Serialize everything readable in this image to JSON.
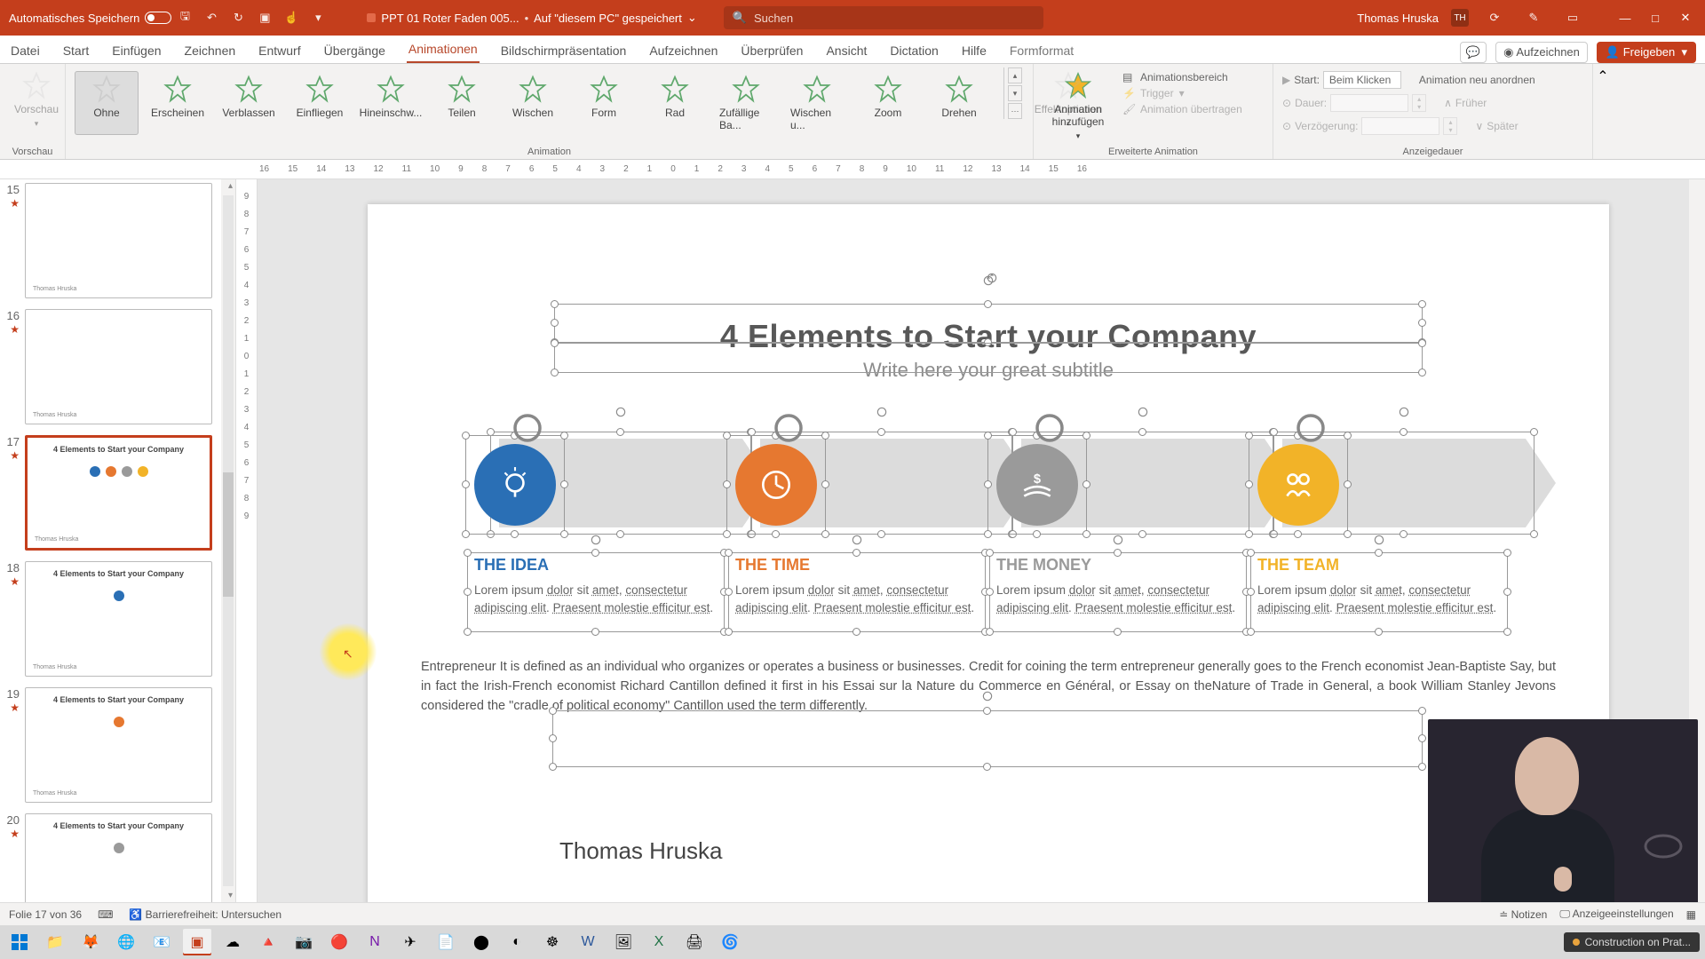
{
  "titlebar": {
    "autosave": "Automatisches Speichern",
    "filename": "PPT 01 Roter Faden 005...",
    "save_location": "Auf \"diesem PC\" gespeichert",
    "search_placeholder": "Suchen",
    "user": "Thomas Hruska",
    "initials": "TH"
  },
  "tabs": {
    "items": [
      "Datei",
      "Start",
      "Einfügen",
      "Zeichnen",
      "Entwurf",
      "Übergänge",
      "Animationen",
      "Bildschirmpräsentation",
      "Aufzeichnen",
      "Überprüfen",
      "Ansicht",
      "Dictation",
      "Hilfe",
      "Formformat"
    ],
    "active": "Animationen",
    "record": "Aufzeichnen",
    "share": "Freigeben"
  },
  "ribbon": {
    "preview": "Vorschau",
    "animation_label": "Animation",
    "gallery": [
      "Ohne",
      "Erscheinen",
      "Verblassen",
      "Einfliegen",
      "Hineinschw...",
      "Teilen",
      "Wischen",
      "Form",
      "Rad",
      "Zufällige Ba...",
      "Wischen u...",
      "Zoom",
      "Drehen"
    ],
    "effect_options": "Effektoptionen",
    "add_anim": "Animation hinzufügen",
    "adv_label": "Erweiterte Animation",
    "pane": "Animationsbereich",
    "trigger": "Trigger",
    "painter": "Animation übertragen",
    "timing_label": "Anzeigedauer",
    "start_lbl": "Start:",
    "start_val": "Beim Klicken",
    "dur_lbl": "Dauer:",
    "delay_lbl": "Verzögerung:",
    "reorder": "Animation neu anordnen",
    "earlier": "Früher",
    "later": "Später"
  },
  "ruler": {
    "h": [
      "16",
      "15",
      "14",
      "13",
      "12",
      "11",
      "10",
      "9",
      "8",
      "7",
      "6",
      "5",
      "4",
      "3",
      "2",
      "1",
      "0",
      "1",
      "2",
      "3",
      "4",
      "5",
      "6",
      "7",
      "8",
      "9",
      "10",
      "11",
      "12",
      "13",
      "14",
      "15",
      "16"
    ],
    "v": [
      "9",
      "8",
      "7",
      "6",
      "5",
      "4",
      "3",
      "2",
      "1",
      "0",
      "1",
      "2",
      "3",
      "4",
      "5",
      "6",
      "7",
      "8",
      "9"
    ]
  },
  "thumbs": [
    {
      "num": "15",
      "title": "",
      "dots": []
    },
    {
      "num": "16",
      "title": "",
      "dots": []
    },
    {
      "num": "17",
      "title": "4 Elements to Start your Company",
      "dots": [
        "#2a6fb5",
        "#e67830",
        "#9a9a9a",
        "#f2b328"
      ],
      "sel": true
    },
    {
      "num": "18",
      "title": "4 Elements to Start your Company",
      "dots": [
        "#2a6fb5"
      ]
    },
    {
      "num": "19",
      "title": "4 Elements to Start your Company",
      "dots": [
        "#e67830"
      ]
    },
    {
      "num": "20",
      "title": "4 Elements to Start your Company",
      "dots": [
        "#9a9a9a"
      ]
    }
  ],
  "slide": {
    "title": "4 Elements to Start your Company",
    "subtitle": "Write here your great subtitle",
    "elements": [
      {
        "title": "THE IDEA",
        "color": "blue"
      },
      {
        "title": "THE TIME",
        "color": "orange"
      },
      {
        "title": "THE MONEY",
        "color": "grey"
      },
      {
        "title": "THE TEAM",
        "color": "gold"
      }
    ],
    "lorem": "Lorem ipsum dolor sit amet, consectetur adipiscing elit. Praesent molestie efficitur est.",
    "para": "Entrepreneur   It is defined as an individual who organizes or operates a business or businesses. Credit for coining the term entrepreneur generally goes to the French economist Jean-Baptiste Say, but in fact the Irish-French economist Richard Cantillon defined it first in his Essai sur la Nature du Commerce en Général, or Essay on theNature of Trade in General, a book William Stanley Jevons considered the \"cradle of political economy\" Cantillon used the term differently.",
    "author": "Thomas Hruska"
  },
  "status": {
    "slide_counter": "Folie 17 von 36",
    "accessibility": "Barrierefreiheit: Untersuchen",
    "notes": "Notizen",
    "display": "Anzeigeeinstellungen"
  },
  "taskbar": {
    "notification": "Construction on Prat..."
  }
}
